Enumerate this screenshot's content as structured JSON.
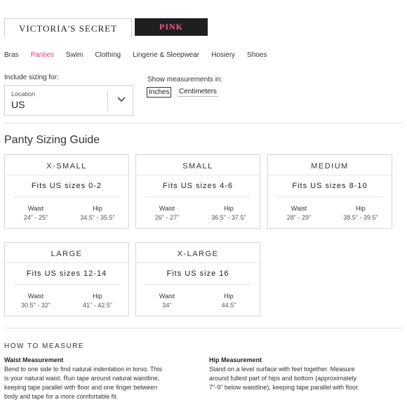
{
  "brand_tabs": {
    "victorias_secret": "VICTORIA'S SECRET",
    "pink": "PINK"
  },
  "nav": [
    "Bras",
    "Panties",
    "Swim",
    "Clothing",
    "Lingerie & Sleepwear",
    "Hosiery",
    "Shoes"
  ],
  "nav_active": "Panties",
  "sizing": {
    "include_label": "Include sizing for:",
    "location_label": "Location",
    "location_value": "US",
    "measurements_label": "Show measurements in:",
    "units": [
      "Inches",
      "Centimeters"
    ],
    "selected_unit": "Inches"
  },
  "guide_title": "Panty Sizing Guide",
  "sizes": [
    {
      "name": "X-SMALL",
      "fits": "Fits US sizes 0-2",
      "waist_label": "Waist",
      "waist": "24\" - 25\"",
      "hip_label": "Hip",
      "hip": "34.5\" - 35.5\""
    },
    {
      "name": "SMALL",
      "fits": "Fits US sizes 4-6",
      "waist_label": "Waist",
      "waist": "26\" - 27\"",
      "hip_label": "Hip",
      "hip": "36.5\" - 37.5\""
    },
    {
      "name": "MEDIUM",
      "fits": "Fits US sizes 8-10",
      "waist_label": "Waist",
      "waist": "28\" - 29\"",
      "hip_label": "Hip",
      "hip": "38.5\" - 39.5\""
    },
    {
      "name": "LARGE",
      "fits": "Fits US sizes 12-14",
      "waist_label": "Waist",
      "waist": "30.5\" - 32\"",
      "hip_label": "Hip",
      "hip": "41\" - 42.5\""
    },
    {
      "name": "X-LARGE",
      "fits": "Fits US size 16",
      "waist_label": "Waist",
      "waist": "34\"",
      "hip_label": "Hip",
      "hip": "44.5\""
    }
  ],
  "how_to": {
    "title": "HOW TO MEASURE",
    "waist": {
      "title": "Waist Measurement",
      "lines": [
        "Bend to one side to find natural indentation in torso. This",
        "is your natural waist. Run tape around natural waistline,",
        "keeping tape parallel with floor and one finger between",
        "body and tape for a more comfortable fit."
      ]
    },
    "hip": {
      "title": "Hip Measurement",
      "lines": [
        "Stand on a level surface with feet together. Measure",
        "around fullest part of hips and bottom (approximately",
        "7\"-9\" below waistline), keeping tape parallel with floor."
      ]
    }
  },
  "colors": {
    "accent_pink": "#e03c6f",
    "pink_logo": "#ee5a93",
    "pink_tab_bg": "#1f1f1f"
  }
}
